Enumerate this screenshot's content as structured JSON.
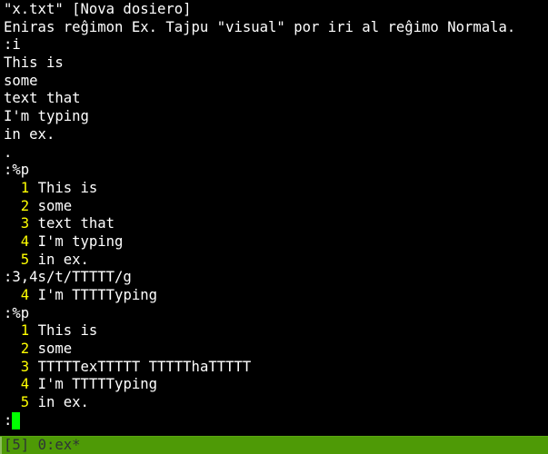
{
  "terminal": {
    "lines": [
      {
        "type": "text",
        "text": "\"x.txt\" [Nova dosiero]"
      },
      {
        "type": "text",
        "text": "Eniras reĝimon Ex. Tajpu \"visual\" por iri al reĝimo Normala."
      },
      {
        "type": "text",
        "text": ":i"
      },
      {
        "type": "text",
        "text": "This is"
      },
      {
        "type": "text",
        "text": "some"
      },
      {
        "type": "text",
        "text": "text that"
      },
      {
        "type": "text",
        "text": "I'm typing"
      },
      {
        "type": "text",
        "text": "in ex."
      },
      {
        "type": "text",
        "text": "."
      },
      {
        "type": "text",
        "text": ":%p"
      },
      {
        "type": "numbered",
        "num": "1",
        "text": "This is"
      },
      {
        "type": "numbered",
        "num": "2",
        "text": "some"
      },
      {
        "type": "numbered",
        "num": "3",
        "text": "text that"
      },
      {
        "type": "numbered",
        "num": "4",
        "text": "I'm typing"
      },
      {
        "type": "numbered",
        "num": "5",
        "text": "in ex."
      },
      {
        "type": "text",
        "text": ":3,4s/t/TTTTT/g"
      },
      {
        "type": "numbered",
        "num": "4",
        "text": "I'm TTTTTyping"
      },
      {
        "type": "text",
        "text": ":%p"
      },
      {
        "type": "numbered",
        "num": "1",
        "text": "This is"
      },
      {
        "type": "numbered",
        "num": "2",
        "text": "some"
      },
      {
        "type": "numbered",
        "num": "3",
        "text": "TTTTTexTTTTT TTTTThaTTTTT"
      },
      {
        "type": "numbered",
        "num": "4",
        "text": "I'm TTTTTyping"
      },
      {
        "type": "numbered",
        "num": "5",
        "text": "in ex."
      },
      {
        "type": "prompt",
        "text": ":"
      }
    ]
  },
  "statusbar": {
    "session": "[5]",
    "window": "0:ex*"
  },
  "colors": {
    "background": "#000000",
    "foreground": "#ffffff",
    "line_number": "#ffff00",
    "cursor": "#00ff00",
    "statusbar_bg": "#4e9a06",
    "statusbar_fg": "#2e3436"
  }
}
